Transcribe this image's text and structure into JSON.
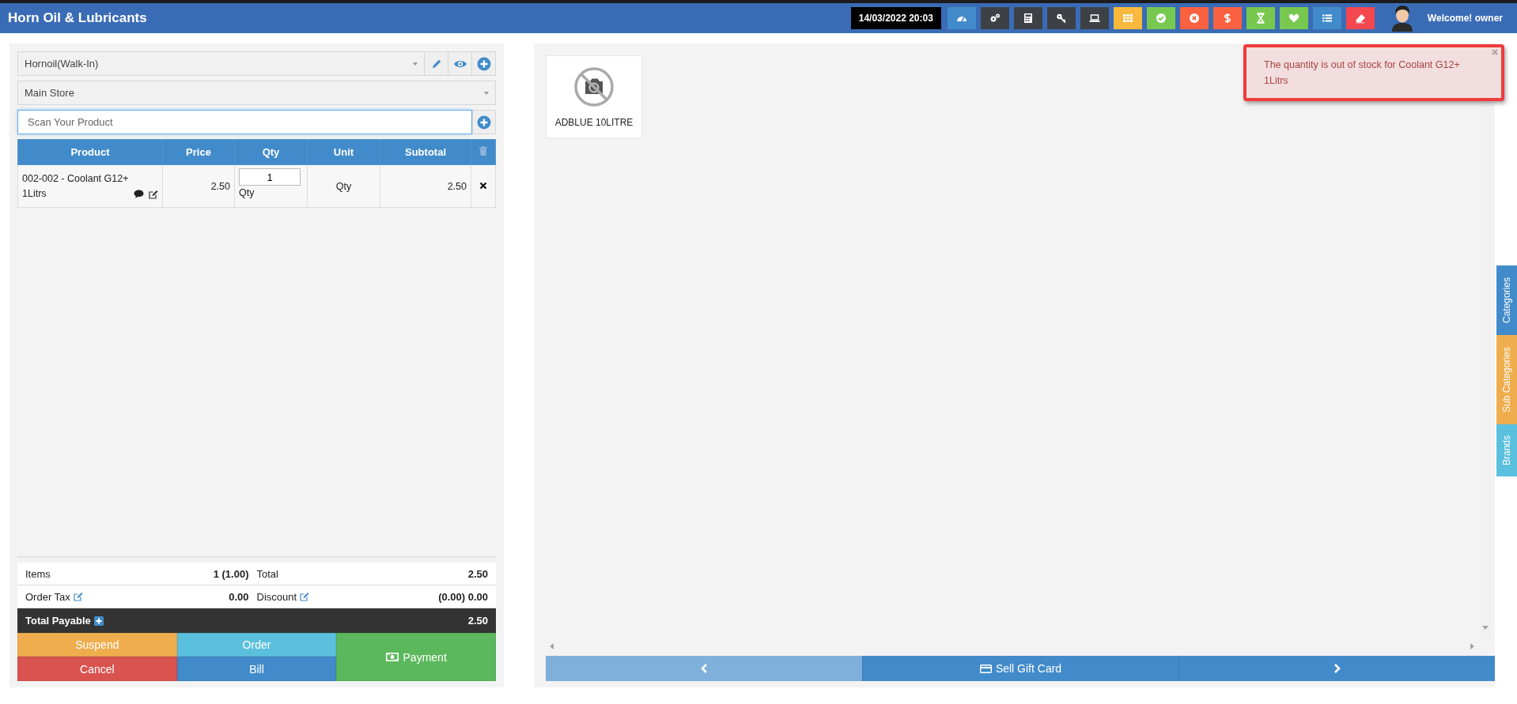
{
  "header": {
    "title": "Horn Oil & Lubricants",
    "datetime": "14/03/2022 20:03",
    "welcome": "Welcome! owner",
    "toolbar": [
      {
        "kind": "dashboard",
        "color": "#428bca"
      },
      {
        "kind": "gears",
        "color": "#3d4146"
      },
      {
        "kind": "calculator",
        "color": "#3d4146"
      },
      {
        "kind": "key",
        "color": "#3d4146"
      },
      {
        "kind": "laptop",
        "color": "#3d4146"
      },
      {
        "kind": "grid",
        "color": "#f8b93c"
      },
      {
        "kind": "check",
        "color": "#78c850"
      },
      {
        "kind": "cross",
        "color": "#fa6140"
      },
      {
        "kind": "dollar",
        "color": "#fa6140"
      },
      {
        "kind": "hourglass",
        "color": "#78c850"
      },
      {
        "kind": "heart",
        "color": "#78c850"
      },
      {
        "kind": "list",
        "color": "#428bca"
      },
      {
        "kind": "eraser",
        "color": "#f4474f"
      }
    ]
  },
  "customer": {
    "value": "Hornoil(Walk-In)"
  },
  "warehouse": {
    "value": "Main Store"
  },
  "scan": {
    "placeholder": "Scan Your Product"
  },
  "order_table": {
    "columns": [
      "Product",
      "Price",
      "Qty",
      "Unit",
      "Subtotal"
    ],
    "rows": [
      {
        "product": "002-002 - Coolant G12+ 1Litrs",
        "price": "2.50",
        "qty": "1",
        "qty_label": "Qty",
        "unit": "Qty",
        "subtotal": "2.50"
      }
    ]
  },
  "totals": {
    "items_label": "Items",
    "items": "1 (1.00)",
    "total_label": "Total",
    "total": "2.50",
    "tax_label": "Order Tax",
    "tax": "0.00",
    "discount_label": "Discount",
    "discount": "(0.00) 0.00",
    "payable_label": "Total Payable",
    "payable": "2.50"
  },
  "actions": [
    {
      "kind": "suspend",
      "label": "Suspend"
    },
    {
      "kind": "order",
      "label": "Order"
    },
    {
      "kind": "payment",
      "label": "Payment"
    },
    {
      "kind": "cancel",
      "label": "Cancel"
    },
    {
      "kind": "bill",
      "label": "Bill"
    }
  ],
  "products": [
    {
      "name": "ADBLUE 10LITRE"
    }
  ],
  "pager": {
    "label": "Sell Gift Card"
  },
  "side_tabs": [
    {
      "label": "Categories",
      "color": "#428bca"
    },
    {
      "label": "Sub Categories",
      "color": "#f0ad4e"
    },
    {
      "label": "Brands",
      "color": "#5bc0de"
    }
  ],
  "alert": {
    "message": "The quantity is out of stock for Coolant G12+ 1Litrs",
    "highlighted": true
  }
}
